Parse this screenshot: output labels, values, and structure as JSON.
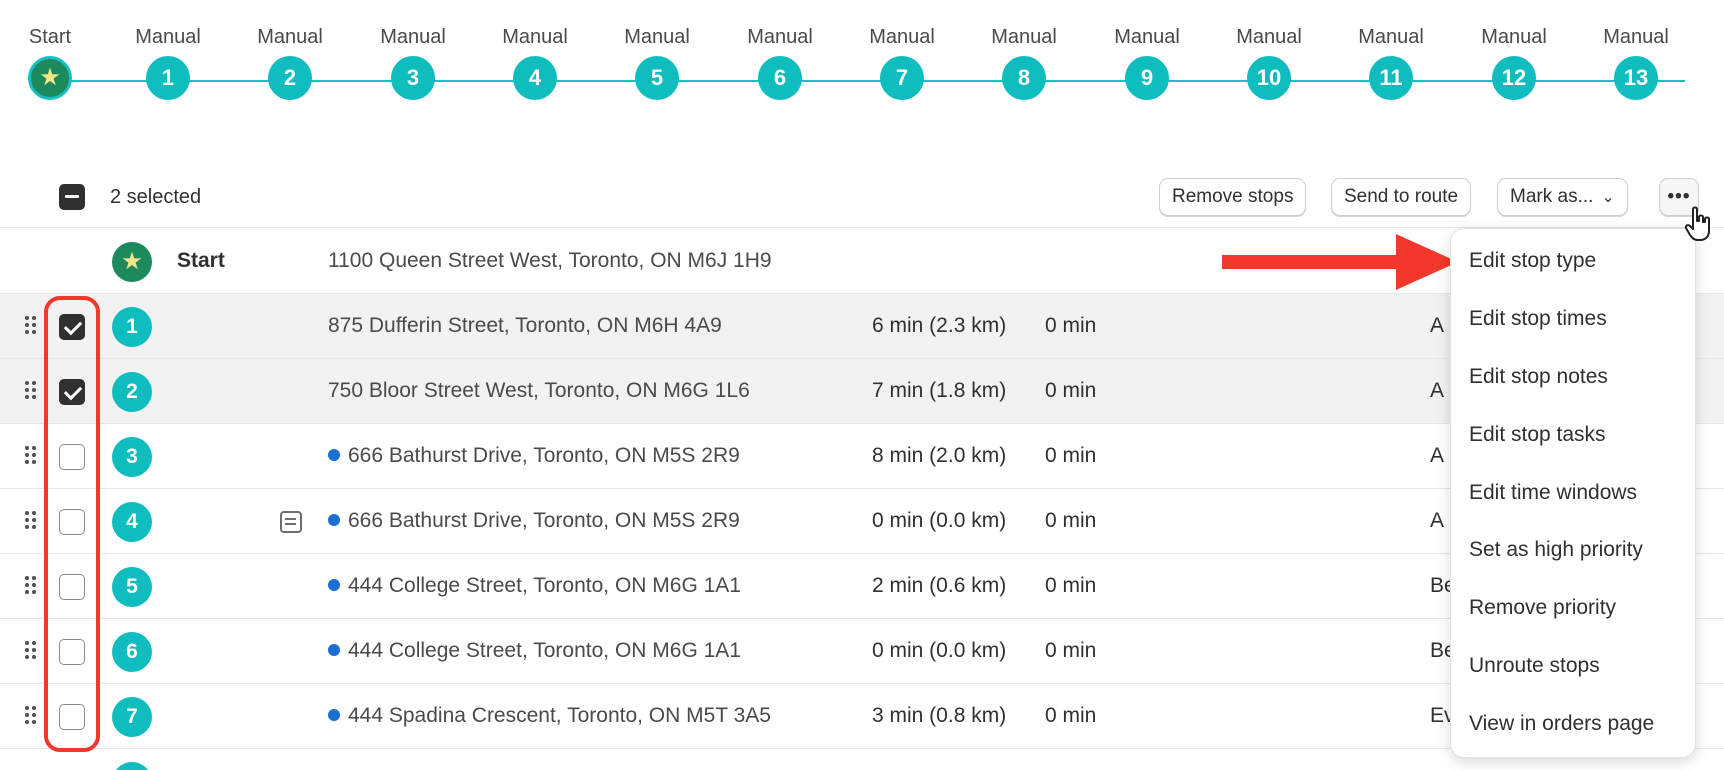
{
  "timeline": {
    "stops": [
      {
        "label": "Start",
        "badge": "",
        "type": "start"
      },
      {
        "label": "Manual",
        "badge": "1"
      },
      {
        "label": "Manual",
        "badge": "2"
      },
      {
        "label": "Manual",
        "badge": "3"
      },
      {
        "label": "Manual",
        "badge": "4"
      },
      {
        "label": "Manual",
        "badge": "5"
      },
      {
        "label": "Manual",
        "badge": "6"
      },
      {
        "label": "Manual",
        "badge": "7"
      },
      {
        "label": "Manual",
        "badge": "8"
      },
      {
        "label": "Manual",
        "badge": "9"
      },
      {
        "label": "Manual",
        "badge": "10"
      },
      {
        "label": "Manual",
        "badge": "11"
      },
      {
        "label": "Manual",
        "badge": "12"
      },
      {
        "label": "Manual",
        "badge": "13"
      }
    ]
  },
  "toolbar": {
    "selected_text": "2 selected",
    "remove_stops": "Remove stops",
    "send_to_route": "Send to route",
    "mark_as": "Mark as...",
    "more": "•••"
  },
  "rows": [
    {
      "badge": "",
      "name": "Start",
      "address": "1100 Queen Street West, Toronto, ON M6J 1H9",
      "travel": "",
      "service": "",
      "extra": "",
      "type": "start"
    },
    {
      "badge": "1",
      "name": "",
      "address": "875 Dufferin Street, Toronto, ON M6H 4A9",
      "travel": "6 min (2.3 km)",
      "service": "0 min",
      "extra": "A",
      "checked": true,
      "dot": false
    },
    {
      "badge": "2",
      "name": "",
      "address": "750 Bloor Street West, Toronto, ON M6G 1L6",
      "travel": "7 min (1.8 km)",
      "service": "0 min",
      "extra": "A",
      "checked": true,
      "dot": false
    },
    {
      "badge": "3",
      "name": "",
      "address": "666 Bathurst Drive, Toronto, ON M5S 2R9",
      "travel": "8 min (2.0 km)",
      "service": "0 min",
      "extra": "A",
      "checked": false,
      "dot": true
    },
    {
      "badge": "4",
      "name": "",
      "address": "666 Bathurst Drive, Toronto, ON M5S 2R9",
      "travel": "0 min (0.0 km)",
      "service": "0 min",
      "extra": "A",
      "checked": false,
      "dot": true,
      "note": true
    },
    {
      "badge": "5",
      "name": "",
      "address": "444 College Street, Toronto, ON M6G 1A1",
      "travel": "2 min (0.6 km)",
      "service": "0 min",
      "extra": "Be",
      "checked": false,
      "dot": true
    },
    {
      "badge": "6",
      "name": "",
      "address": "444 College Street, Toronto, ON M6G 1A1",
      "travel": "0 min (0.0 km)",
      "service": "0 min",
      "extra": "Be",
      "checked": false,
      "dot": true
    },
    {
      "badge": "7",
      "name": "",
      "address": "444 Spadina Crescent, Toronto, ON M5T 3A5",
      "travel": "3 min (0.8 km)",
      "service": "0 min",
      "extra": "Ev",
      "checked": false,
      "dot": true
    }
  ],
  "menu": {
    "items": [
      "Edit stop type",
      "Edit stop times",
      "Edit stop notes",
      "Edit stop tasks",
      "Edit time windows",
      "Set as high priority",
      "Remove priority",
      "Unroute stops",
      "View in orders page"
    ]
  },
  "colors": {
    "teal": "#0fbdbf",
    "start_green": "#1c8a5c",
    "annotation_red": "#f2382a",
    "dot_blue": "#1a6fd1"
  }
}
